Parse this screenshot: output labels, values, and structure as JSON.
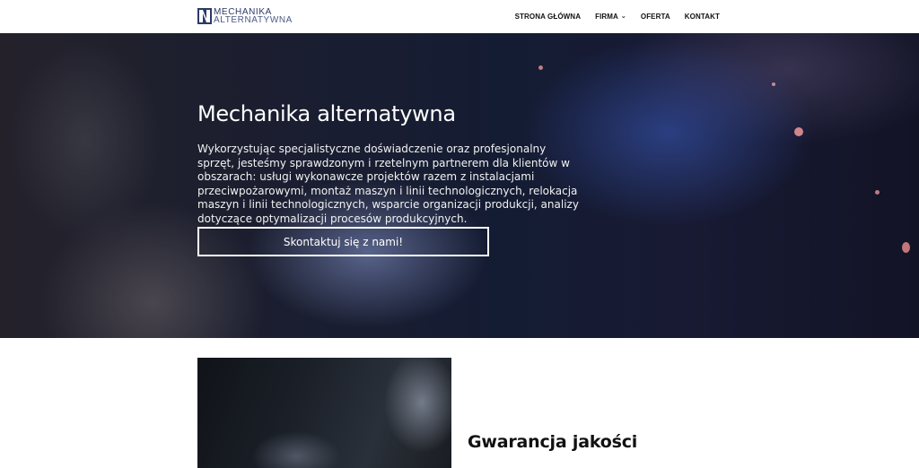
{
  "brand": {
    "line1": "MECHANIKA",
    "line2": "ALTERNATYWNA",
    "colors": {
      "navy": "#2b3a66",
      "accent": "#4b5a84"
    }
  },
  "nav": {
    "items": [
      {
        "label": "STRONA GŁÓWNA",
        "has_dropdown": false
      },
      {
        "label": "FIRMA",
        "has_dropdown": true
      },
      {
        "label": "OFERTA",
        "has_dropdown": false
      },
      {
        "label": "KONTAKT",
        "has_dropdown": false
      }
    ]
  },
  "hero": {
    "title": "Mechanika alternatywna",
    "text": "Wykorzystując specjalistyczne doświadczenie oraz profesjonalny sprzęt, jesteśmy sprawdzonym i rzetelnym partnerem dla klientów w obszarach: usługi wykonawcze projektów razem z instalacjami przeciwpożarowymi, montaż maszyn i linii technologicznych, relokacja maszyn i linii technologicznych, wsparcie organizacji produkcji, analizy dotyczące optymalizacji procesów produkcyjnych.",
    "cta_label": "Skontaktuj się z nami!"
  },
  "feature": {
    "title": "Gwarancja jakości"
  }
}
